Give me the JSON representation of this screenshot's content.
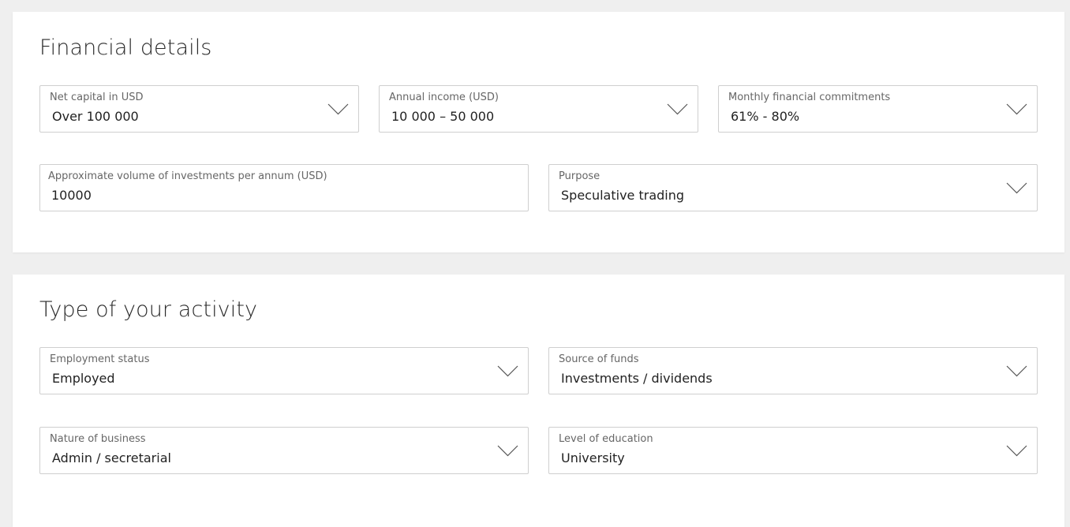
{
  "financial": {
    "title": "Financial details",
    "net_capital": {
      "label": "Net capital in USD",
      "value": "Over 100 000",
      "icon": "chevron-down-icon"
    },
    "annual_income": {
      "label": "Annual income (USD)",
      "value": "10 000 – 50 000",
      "icon": "chevron-down-icon"
    },
    "monthly_commitments": {
      "label": "Monthly financial commitments",
      "value": "61% - 80%",
      "icon": "chevron-down-icon"
    },
    "investment_volume": {
      "label": "Approximate volume of investments per annum (USD)",
      "value": "10000"
    },
    "purpose": {
      "label": "Purpose",
      "value": "Speculative trading",
      "icon": "chevron-down-icon"
    }
  },
  "activity": {
    "title": "Type of your activity",
    "employment_status": {
      "label": "Employment status",
      "value": "Employed",
      "icon": "chevron-down-icon"
    },
    "source_of_funds": {
      "label": "Source of funds",
      "value": "Investments / dividends",
      "icon": "chevron-down-icon"
    },
    "nature_of_business": {
      "label": "Nature of business",
      "value": "Admin / secretarial",
      "icon": "chevron-down-icon"
    },
    "education": {
      "label": "Level of education",
      "value": "University",
      "icon": "chevron-down-icon"
    }
  },
  "colors": {
    "background": "#efefef",
    "card": "#ffffff",
    "border": "#cfcfcf",
    "label": "#666666",
    "text": "#222222",
    "chevron": "#555555"
  }
}
